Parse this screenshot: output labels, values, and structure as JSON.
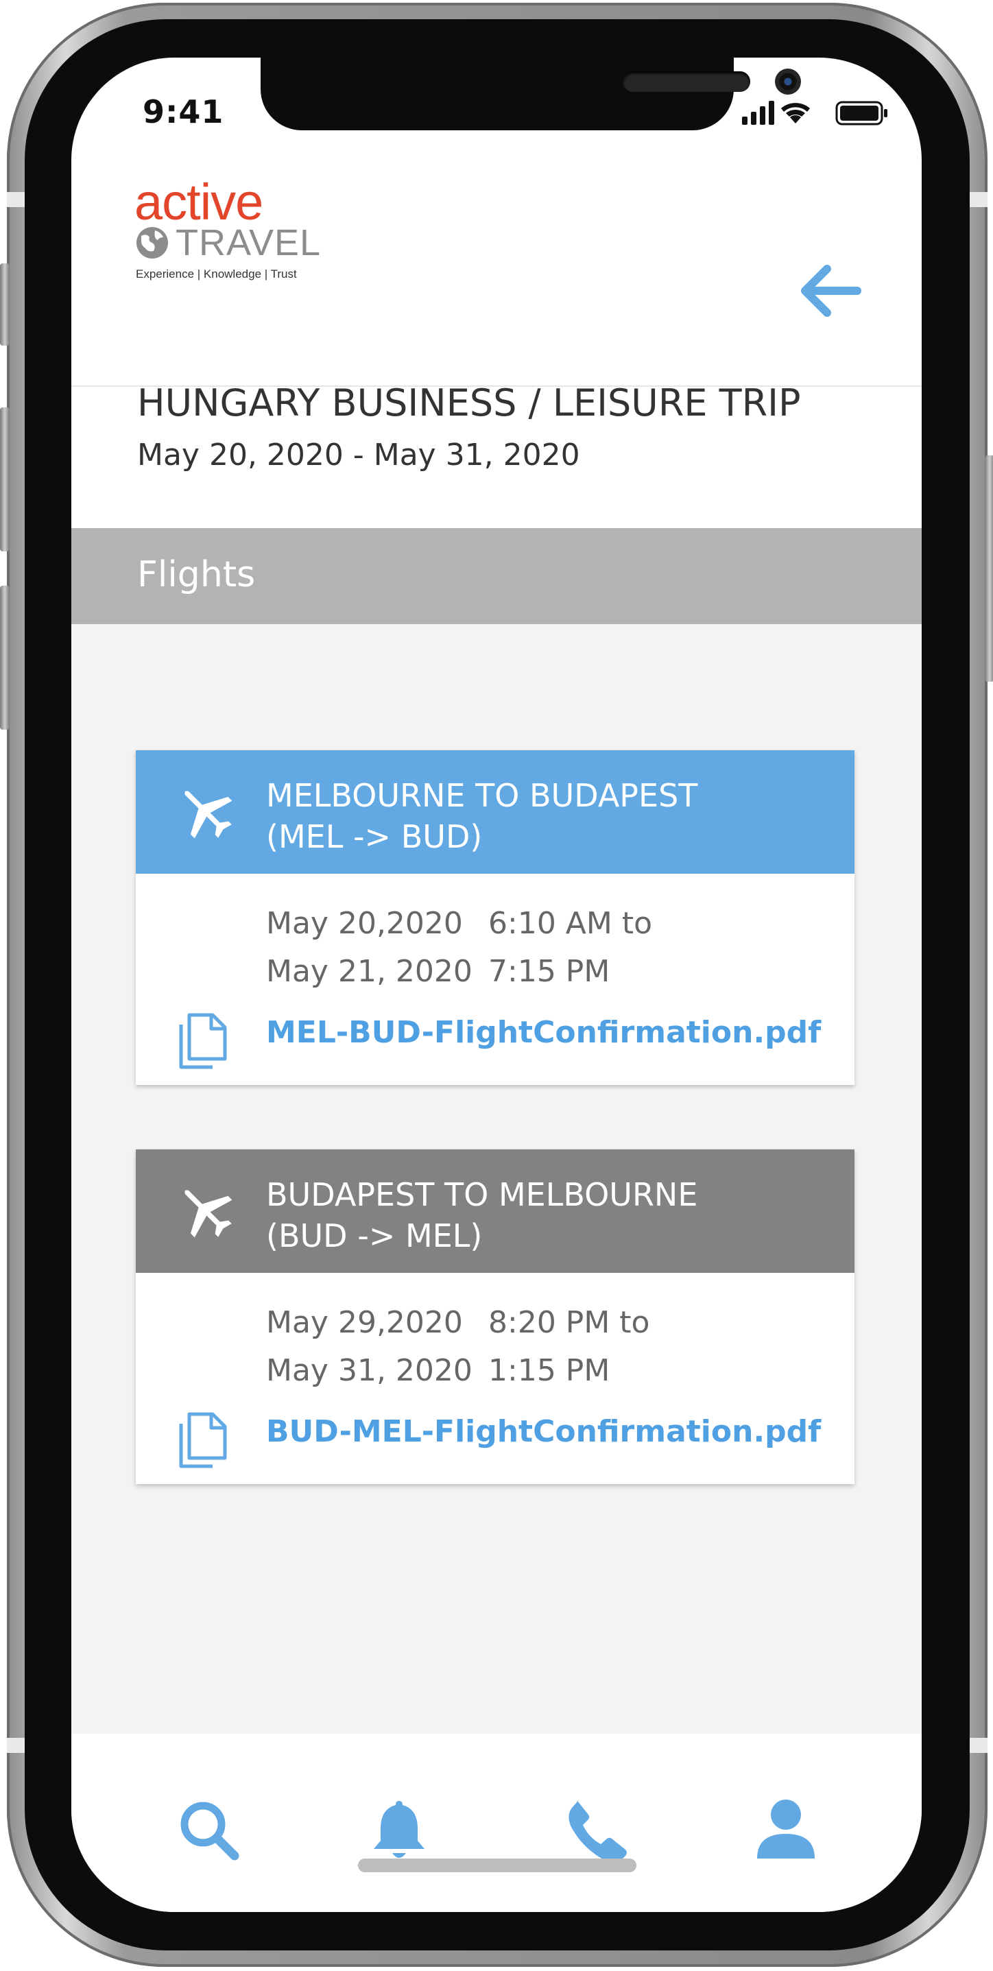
{
  "status_bar": {
    "time": "9:41"
  },
  "header": {
    "logo_primary": "active",
    "logo_secondary": "TRAVEL",
    "logo_tagline": "Experience | Knowledge | Trust",
    "back_icon": "arrow-left-icon",
    "accent": "#62a9e3",
    "logo_color": "#e2452a"
  },
  "trip": {
    "title": "HUNGARY BUSINESS / LEISURE TRIP",
    "dates": "May 20, 2020 - May 31, 2020"
  },
  "section": {
    "label": "Flights"
  },
  "flights": [
    {
      "route_line1": "MELBOURNE TO BUDAPEST",
      "route_line2": "(MEL -> BUD)",
      "depart_date": "May 20,2020",
      "depart_time": "6:10 AM to",
      "arrive_date": "May 21, 2020",
      "arrive_time": "7:15 PM",
      "document": "MEL-BUD-FlightConfirmation.pdf",
      "header_color": "#62a9e3"
    },
    {
      "route_line1": "BUDAPEST TO MELBOURNE",
      "route_line2": "(BUD -> MEL)",
      "depart_date": "May 29,2020",
      "depart_time": "8:20 PM to",
      "arrive_date": "May 31, 2020",
      "arrive_time": "1:15 PM",
      "document": "BUD-MEL-FlightConfirmation.pdf",
      "header_color": "#828282"
    }
  ],
  "tabbar": {
    "items": [
      "search-icon",
      "bell-icon",
      "phone-icon",
      "user-icon"
    ]
  }
}
